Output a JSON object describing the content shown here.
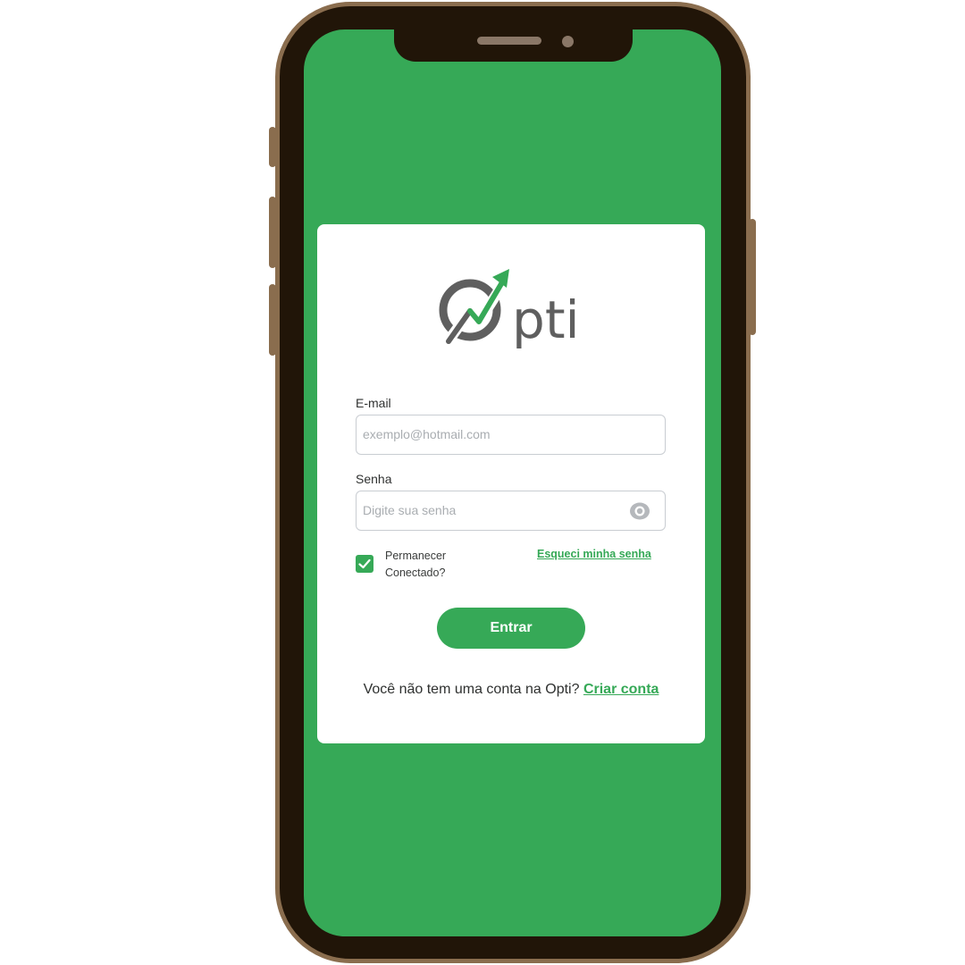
{
  "brand": {
    "name": "pti",
    "accent": "#36a957",
    "logo_gray": "#5f5f5f"
  },
  "login": {
    "email_label": "E-mail",
    "email_placeholder": "exemplo@hotmail.com",
    "password_label": "Senha",
    "password_placeholder": "Digite sua senha",
    "stay_connected_line1": "Permanecer",
    "stay_connected_line2": "Conectado?",
    "stay_connected_checked": true,
    "forgot_password": "Esqueci minha senha",
    "submit_label": "Entrar",
    "signup_prompt": "Você não tem uma conta na Opti?",
    "signup_link": "Criar conta"
  },
  "icons": {
    "password_toggle": "eye-icon",
    "checkbox": "check-icon"
  }
}
